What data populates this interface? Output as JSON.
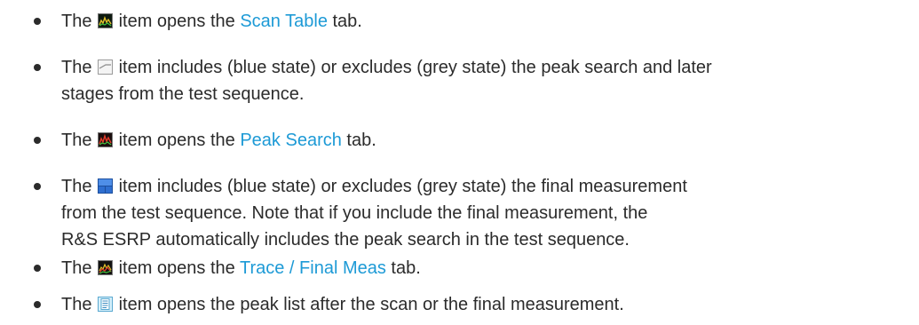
{
  "items": [
    {
      "icon": "scan-spectrum-icon",
      "before": "The ",
      "after": " item opens the ",
      "link": "Scan Table",
      "tail": " tab."
    },
    {
      "icon": "peak-search-toggle-icon",
      "before": "The ",
      "line1": " item includes (blue state) or excludes (grey state) the peak search and later",
      "line2": "stages from the test sequence."
    },
    {
      "icon": "peak-spectrum-icon",
      "before": "The ",
      "after": " item opens the ",
      "link": "Peak Search",
      "tail": " tab."
    },
    {
      "icon": "final-measurement-toggle-icon",
      "before": "The ",
      "line1": " item includes (blue state) or excludes (grey state) the final measurement",
      "line2": "from the test sequence. Note that if you include the final measurement, the",
      "line3": "R&S ESRP automatically includes the peak search in the test sequence."
    },
    {
      "icon": "trace-final-meas-icon",
      "before": "The ",
      "after": " item opens the ",
      "link": "Trace / Final Meas",
      "tail": " tab."
    },
    {
      "icon": "peak-list-icon",
      "before": "The ",
      "line1": " item opens the peak list after the scan or the final measurement."
    }
  ],
  "colors": {
    "text": "#2b2b2b",
    "link": "#1d9ad6"
  }
}
